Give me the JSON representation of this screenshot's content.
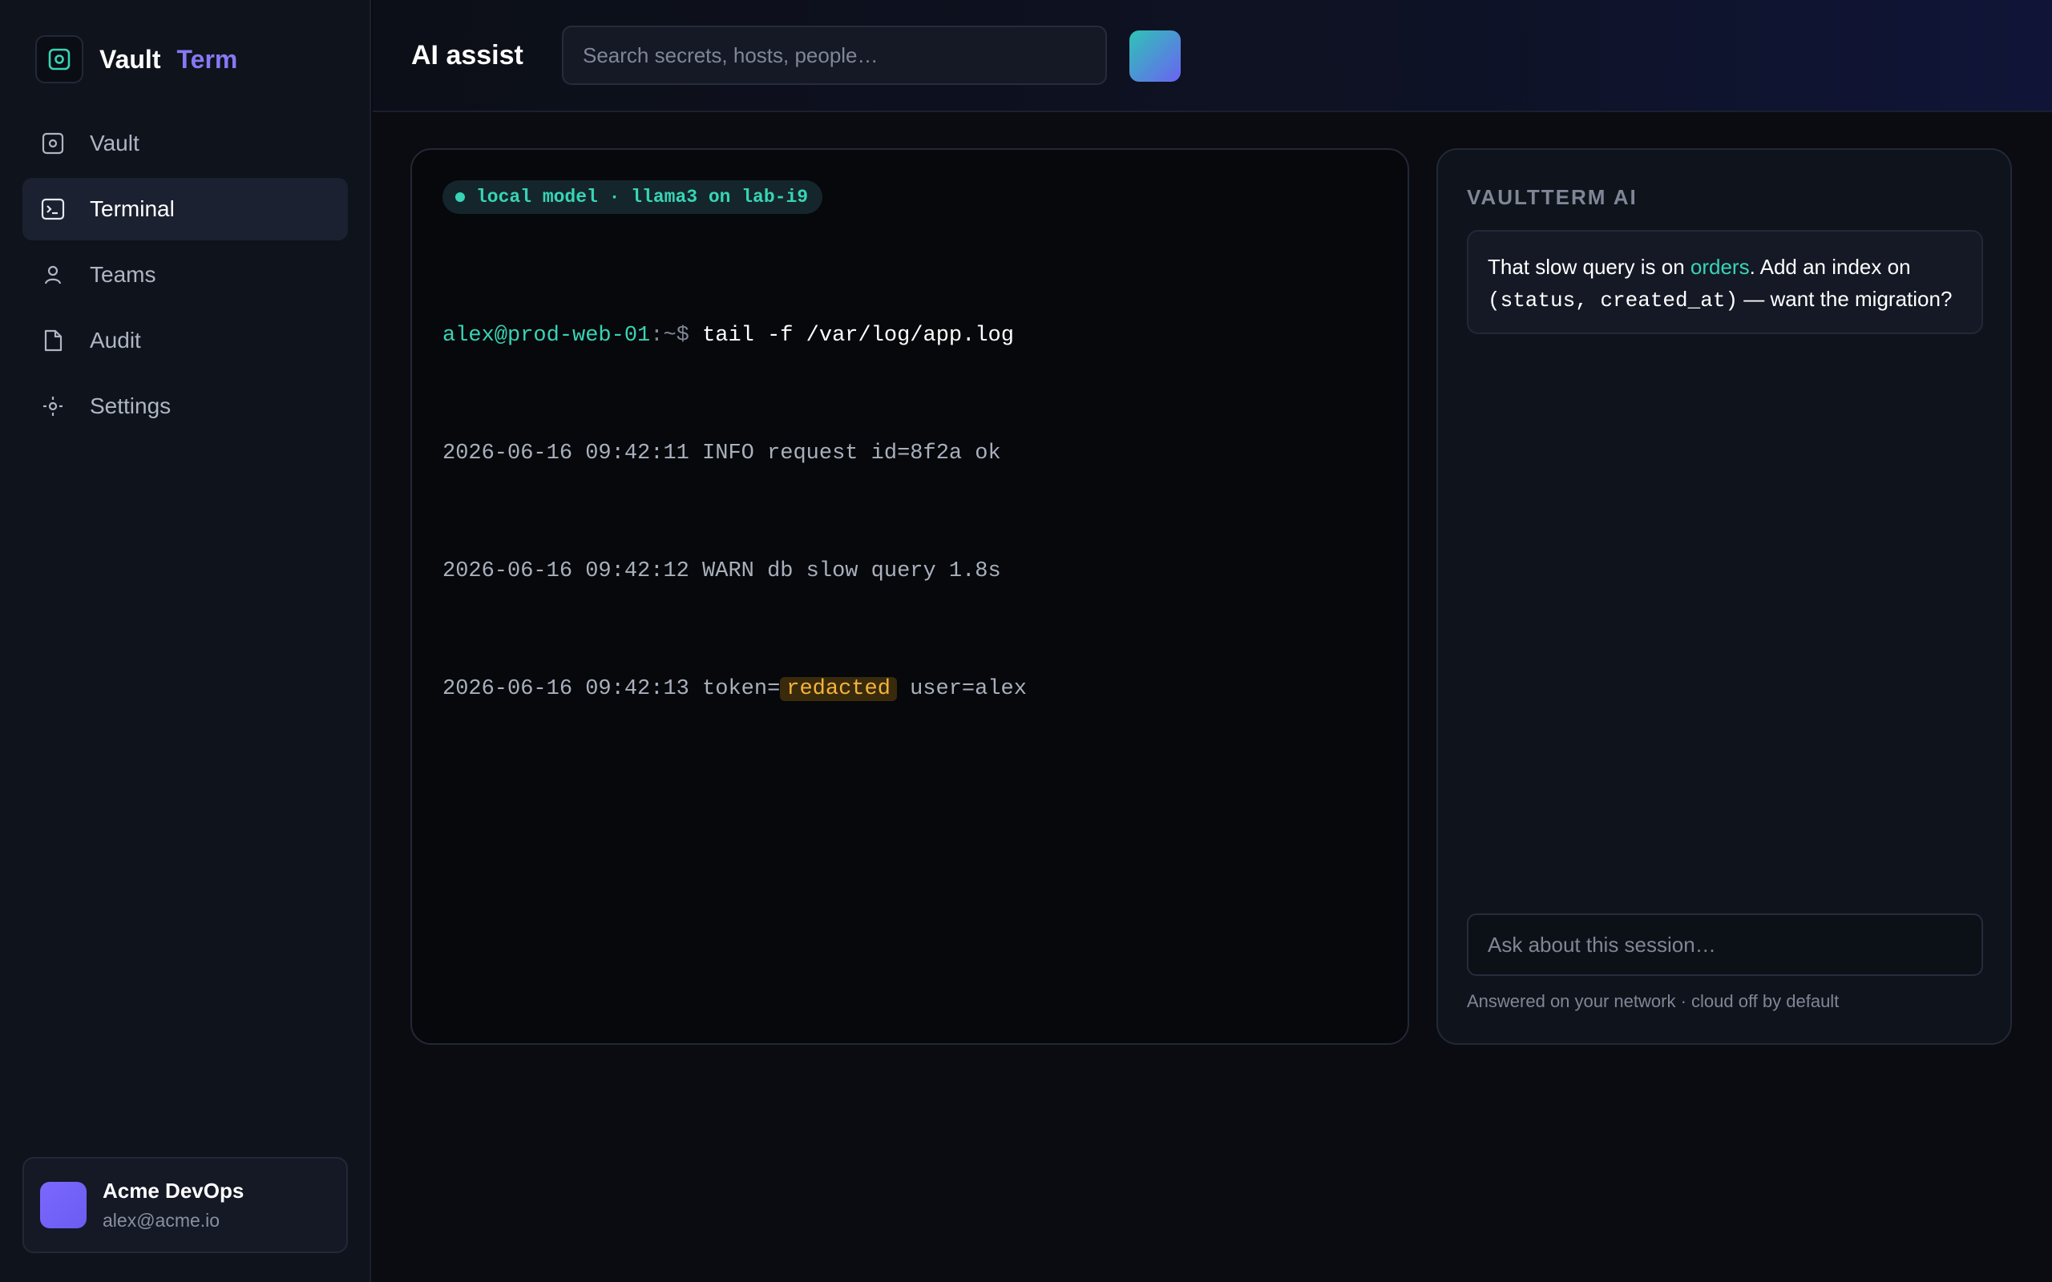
{
  "brand": {
    "name": "Vault",
    "accent": "Term"
  },
  "sidebar": {
    "items": [
      {
        "label": "Vault",
        "icon": "vault-icon",
        "active": false
      },
      {
        "label": "Terminal",
        "icon": "terminal-icon",
        "active": true
      },
      {
        "label": "Teams",
        "icon": "user-icon",
        "active": false
      },
      {
        "label": "Audit",
        "icon": "document-icon",
        "active": false
      },
      {
        "label": "Settings",
        "icon": "gear-icon",
        "active": false
      }
    ],
    "account": {
      "name": "Acme DevOps",
      "email": "alex@acme.io"
    }
  },
  "header": {
    "title": "AI assist",
    "search_placeholder": "Search secrets, hosts, people…"
  },
  "terminal": {
    "model_badge": "local model · llama3 on lab-i9",
    "prompt_host": "alex@prod-web-01",
    "prompt_path": ":~$ ",
    "command": "tail -f /var/log/app.log",
    "log_lines": [
      "2026-06-16 09:42:11 INFO request id=8f2a ok",
      "2026-06-16 09:42:12 WARN db slow query 1.8s"
    ],
    "token_line": {
      "prefix": "2026-06-16 09:42:13 token=",
      "redacted": "redacted",
      "suffix": " user=alex"
    }
  },
  "ai": {
    "heading": "VAULTTERM AI",
    "message": {
      "part1": "That slow query is on ",
      "highlight": "orders",
      "part2": ". Add an index on",
      "code": "(status, created_at)",
      "part3": " — want the migration?"
    },
    "input_placeholder": "Ask about this session…",
    "footnote": "Answered on your network · cloud off by default"
  },
  "colors": {
    "accent_teal": "#38d4b6",
    "accent_purple": "#8678f5",
    "redacted_amber": "#f3b43b",
    "background": "#0a0c11"
  }
}
